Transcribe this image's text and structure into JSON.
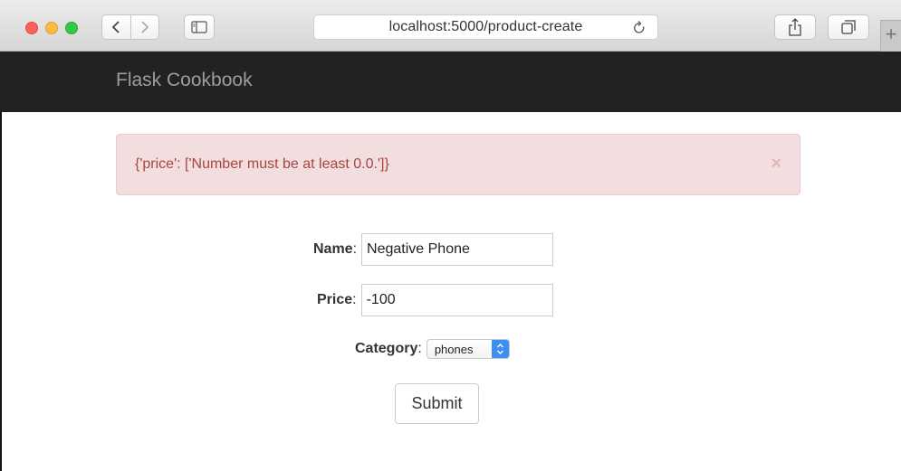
{
  "browser": {
    "url": "localhost:5000/product-create",
    "new_tab_glyph": "+",
    "icons": [
      "back-icon",
      "forward-icon",
      "sidebar-icon",
      "reload-icon",
      "share-icon",
      "tabs-icon"
    ]
  },
  "navbar": {
    "brand": "Flask Cookbook",
    "background": "#222222"
  },
  "alert": {
    "message": "{'price': ['Number must be at least 0.0.']}",
    "close_glyph": "×",
    "text_color": "#a94442",
    "background": "#f2dede"
  },
  "form": {
    "name_label": "Name",
    "name_value": "Negative Phone",
    "price_label": "Price",
    "price_value": "-100",
    "category_label": "Category",
    "category_value": "phones",
    "colon": ":",
    "submit_label": "Submit"
  }
}
